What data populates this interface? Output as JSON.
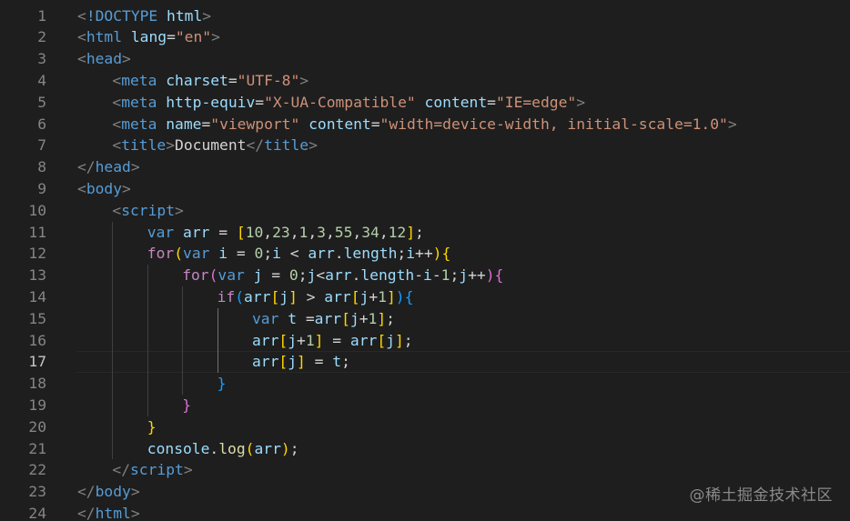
{
  "editor": {
    "active_line": 17,
    "lines": [
      {
        "n": 1,
        "indent": 0,
        "tokens": [
          [
            "br",
            "<"
          ],
          [
            "tag",
            "!DOCTYPE"
          ],
          [
            "txt",
            " "
          ],
          [
            "attr",
            "html"
          ],
          [
            "br",
            ">"
          ]
        ]
      },
      {
        "n": 2,
        "indent": 0,
        "tokens": [
          [
            "br",
            "<"
          ],
          [
            "tag",
            "html"
          ],
          [
            "txt",
            " "
          ],
          [
            "attr",
            "lang"
          ],
          [
            "txt",
            "="
          ],
          [
            "str",
            "\"en\""
          ],
          [
            "br",
            ">"
          ]
        ]
      },
      {
        "n": 3,
        "indent": 0,
        "tokens": [
          [
            "br",
            "<"
          ],
          [
            "tag",
            "head"
          ],
          [
            "br",
            ">"
          ]
        ]
      },
      {
        "n": 4,
        "indent": 1,
        "tokens": [
          [
            "br",
            "<"
          ],
          [
            "tag",
            "meta"
          ],
          [
            "txt",
            " "
          ],
          [
            "attr",
            "charset"
          ],
          [
            "txt",
            "="
          ],
          [
            "str",
            "\"UTF-8\""
          ],
          [
            "br",
            ">"
          ]
        ]
      },
      {
        "n": 5,
        "indent": 1,
        "tokens": [
          [
            "br",
            "<"
          ],
          [
            "tag",
            "meta"
          ],
          [
            "txt",
            " "
          ],
          [
            "attr",
            "http-equiv"
          ],
          [
            "txt",
            "="
          ],
          [
            "str",
            "\"X-UA-Compatible\""
          ],
          [
            "txt",
            " "
          ],
          [
            "attr",
            "content"
          ],
          [
            "txt",
            "="
          ],
          [
            "str",
            "\"IE=edge\""
          ],
          [
            "br",
            ">"
          ]
        ]
      },
      {
        "n": 6,
        "indent": 1,
        "tokens": [
          [
            "br",
            "<"
          ],
          [
            "tag",
            "meta"
          ],
          [
            "txt",
            " "
          ],
          [
            "attr",
            "name"
          ],
          [
            "txt",
            "="
          ],
          [
            "str",
            "\"viewport\""
          ],
          [
            "txt",
            " "
          ],
          [
            "attr",
            "content"
          ],
          [
            "txt",
            "="
          ],
          [
            "str",
            "\"width=device-width, initial-scale=1.0\""
          ],
          [
            "br",
            ">"
          ]
        ]
      },
      {
        "n": 7,
        "indent": 1,
        "tokens": [
          [
            "br",
            "<"
          ],
          [
            "tag",
            "title"
          ],
          [
            "br",
            ">"
          ],
          [
            "txt",
            "Document"
          ],
          [
            "br",
            "</"
          ],
          [
            "tag",
            "title"
          ],
          [
            "br",
            ">"
          ]
        ]
      },
      {
        "n": 8,
        "indent": 0,
        "tokens": [
          [
            "br",
            "</"
          ],
          [
            "tag",
            "head"
          ],
          [
            "br",
            ">"
          ]
        ]
      },
      {
        "n": 9,
        "indent": 0,
        "tokens": [
          [
            "br",
            "<"
          ],
          [
            "tag",
            "body"
          ],
          [
            "br",
            ">"
          ]
        ]
      },
      {
        "n": 10,
        "indent": 1,
        "tokens": [
          [
            "br",
            "<"
          ],
          [
            "tag",
            "script"
          ],
          [
            "br",
            ">"
          ]
        ]
      },
      {
        "n": 11,
        "indent": 2,
        "tokens": [
          [
            "kw",
            "var"
          ],
          [
            "txt",
            " "
          ],
          [
            "attr",
            "arr"
          ],
          [
            "txt",
            " = "
          ],
          [
            "b1",
            "["
          ],
          [
            "num",
            "10"
          ],
          [
            "txt",
            ","
          ],
          [
            "num",
            "23"
          ],
          [
            "txt",
            ","
          ],
          [
            "num",
            "1"
          ],
          [
            "txt",
            ","
          ],
          [
            "num",
            "3"
          ],
          [
            "txt",
            ","
          ],
          [
            "num",
            "55"
          ],
          [
            "txt",
            ","
          ],
          [
            "num",
            "34"
          ],
          [
            "txt",
            ","
          ],
          [
            "num",
            "12"
          ],
          [
            "b1",
            "]"
          ],
          [
            "txt",
            ";"
          ]
        ]
      },
      {
        "n": 12,
        "indent": 2,
        "tokens": [
          [
            "ctl",
            "for"
          ],
          [
            "b1",
            "("
          ],
          [
            "kw",
            "var"
          ],
          [
            "txt",
            " "
          ],
          [
            "attr",
            "i"
          ],
          [
            "txt",
            " = "
          ],
          [
            "num",
            "0"
          ],
          [
            "txt",
            ";"
          ],
          [
            "attr",
            "i"
          ],
          [
            "txt",
            " < "
          ],
          [
            "attr",
            "arr"
          ],
          [
            "txt",
            "."
          ],
          [
            "attr",
            "length"
          ],
          [
            "txt",
            ";"
          ],
          [
            "attr",
            "i"
          ],
          [
            "txt",
            "++"
          ],
          [
            "b1",
            ")"
          ],
          [
            "b1",
            "{"
          ]
        ]
      },
      {
        "n": 13,
        "indent": 3,
        "tokens": [
          [
            "ctl",
            "for"
          ],
          [
            "b2",
            "("
          ],
          [
            "kw",
            "var"
          ],
          [
            "txt",
            " "
          ],
          [
            "attr",
            "j"
          ],
          [
            "txt",
            " = "
          ],
          [
            "num",
            "0"
          ],
          [
            "txt",
            ";"
          ],
          [
            "attr",
            "j"
          ],
          [
            "txt",
            "<"
          ],
          [
            "attr",
            "arr"
          ],
          [
            "txt",
            "."
          ],
          [
            "attr",
            "length"
          ],
          [
            "txt",
            "-"
          ],
          [
            "attr",
            "i"
          ],
          [
            "txt",
            "-"
          ],
          [
            "num",
            "1"
          ],
          [
            "txt",
            ";"
          ],
          [
            "attr",
            "j"
          ],
          [
            "txt",
            "++"
          ],
          [
            "b2",
            ")"
          ],
          [
            "b2",
            "{"
          ]
        ]
      },
      {
        "n": 14,
        "indent": 4,
        "tokens": [
          [
            "ctl",
            "if"
          ],
          [
            "b3",
            "("
          ],
          [
            "attr",
            "arr"
          ],
          [
            "b1",
            "["
          ],
          [
            "attr",
            "j"
          ],
          [
            "b1",
            "]"
          ],
          [
            "txt",
            " > "
          ],
          [
            "attr",
            "arr"
          ],
          [
            "b1",
            "["
          ],
          [
            "attr",
            "j"
          ],
          [
            "txt",
            "+"
          ],
          [
            "num",
            "1"
          ],
          [
            "b1",
            "]"
          ],
          [
            "b3",
            ")"
          ],
          [
            "b3",
            "{"
          ]
        ]
      },
      {
        "n": 15,
        "indent": 5,
        "tokens": [
          [
            "kw",
            "var"
          ],
          [
            "txt",
            " "
          ],
          [
            "attr",
            "t"
          ],
          [
            "txt",
            " ="
          ],
          [
            "attr",
            "arr"
          ],
          [
            "b1",
            "["
          ],
          [
            "attr",
            "j"
          ],
          [
            "txt",
            "+"
          ],
          [
            "num",
            "1"
          ],
          [
            "b1",
            "]"
          ],
          [
            "txt",
            ";"
          ]
        ]
      },
      {
        "n": 16,
        "indent": 5,
        "tokens": [
          [
            "attr",
            "arr"
          ],
          [
            "b1",
            "["
          ],
          [
            "attr",
            "j"
          ],
          [
            "txt",
            "+"
          ],
          [
            "num",
            "1"
          ],
          [
            "b1",
            "]"
          ],
          [
            "txt",
            " = "
          ],
          [
            "attr",
            "arr"
          ],
          [
            "b1",
            "["
          ],
          [
            "attr",
            "j"
          ],
          [
            "b1",
            "]"
          ],
          [
            "txt",
            ";"
          ]
        ]
      },
      {
        "n": 17,
        "indent": 5,
        "tokens": [
          [
            "attr",
            "arr"
          ],
          [
            "b1",
            "["
          ],
          [
            "attr",
            "j"
          ],
          [
            "b1",
            "]"
          ],
          [
            "txt",
            " = "
          ],
          [
            "attr",
            "t"
          ],
          [
            "txt",
            ";"
          ]
        ]
      },
      {
        "n": 18,
        "indent": 4,
        "tokens": [
          [
            "b3",
            "}"
          ]
        ]
      },
      {
        "n": 19,
        "indent": 3,
        "tokens": [
          [
            "b2",
            "}"
          ]
        ]
      },
      {
        "n": 20,
        "indent": 2,
        "tokens": [
          [
            "b1",
            "}"
          ]
        ]
      },
      {
        "n": 21,
        "indent": 2,
        "tokens": [
          [
            "attr",
            "console"
          ],
          [
            "txt",
            "."
          ],
          [
            "fn",
            "log"
          ],
          [
            "b1",
            "("
          ],
          [
            "attr",
            "arr"
          ],
          [
            "b1",
            ")"
          ],
          [
            "txt",
            ";"
          ]
        ]
      },
      {
        "n": 22,
        "indent": 1,
        "tokens": [
          [
            "br",
            "</"
          ],
          [
            "tag",
            "script"
          ],
          [
            "br",
            ">"
          ]
        ]
      },
      {
        "n": 23,
        "indent": 0,
        "tokens": [
          [
            "br",
            "</"
          ],
          [
            "tag",
            "body"
          ],
          [
            "br",
            ">"
          ]
        ]
      },
      {
        "n": 24,
        "indent": 0,
        "tokens": [
          [
            "br",
            "</"
          ],
          [
            "tag",
            "html"
          ],
          [
            "br",
            ">"
          ]
        ]
      }
    ],
    "colors": {
      "background": "#1e1e1e",
      "tag": "#569cd6",
      "attribute": "#9cdcfe",
      "string": "#ce9178",
      "number": "#b5cea8",
      "control_keyword": "#c586c0",
      "bracket_level_1": "#ffd700",
      "bracket_level_2": "#da70d6",
      "bracket_level_3": "#179fff",
      "function": "#dcdcaa"
    }
  },
  "watermark": {
    "text": "@稀土掘金技术社区"
  }
}
